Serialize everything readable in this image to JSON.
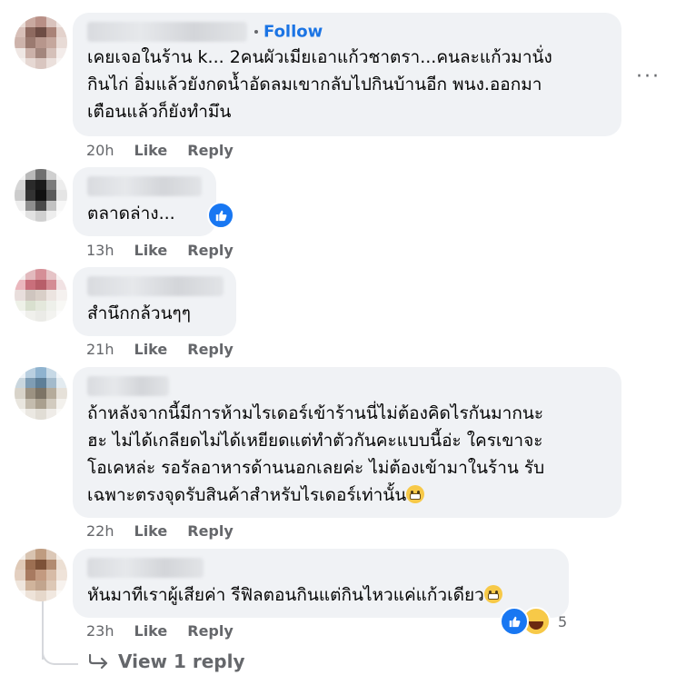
{
  "colors": {
    "bubble": "#f0f2f5",
    "link": "#1b74e4",
    "meta": "#65676b",
    "like_blue": "#1877f2"
  },
  "comments": [
    {
      "follow_label": "Follow",
      "text": "เคยเจอในร้าน k... 2คนผัวเมียเอาแก้วชาตรา...คนละแก้วมานั่ง\nกินไก่ อิ่มแล้วยังกดน้ำอัดลมเขากลับไปกินบ้านอีก พนง.ออกมา\nเตือนแล้วก็ยังทำมึน",
      "time": "20h",
      "like": "Like",
      "reply": "Reply"
    },
    {
      "text": "ตลาดล่าง...",
      "time": "13h",
      "like": "Like",
      "reply": "Reply",
      "reaction_icon": "like-icon"
    },
    {
      "text": "สำนึกกล้วนๆๆ",
      "time": "21h",
      "like": "Like",
      "reply": "Reply"
    },
    {
      "text": "ถ้าหลังจากนี้มีการห้ามไรเดอร์เข้าร้านนี่ไม่ต้องคิดไรกันมากนะ\nฮะ ไม่ได้เกลียดไม่ได้เหยียดแต่ทำตัวกันคะแบบนี้อ่ะ ใครเขาจะ\nโอเคหล่ะ รอรัลอาหารด้านนอกเลยค่ะ ไม่ต้องเข้ามาในร้าน รับ\nเฉพาะตรงจุดรับสินค้าสำหรับไรเดอร์เท่านั้น",
      "emoji": "grimacing-emoji",
      "time": "22h",
      "like": "Like",
      "reply": "Reply"
    },
    {
      "text": "หันมาทีเราผู้เสียค่า รีฟิลตอนกินแต่กินไหวแค่แก้วเดียว",
      "emoji": "sweat-smile-emoji",
      "time": "23h",
      "like": "Like",
      "reply": "Reply",
      "reactions": {
        "icons": [
          "like-icon",
          "haha-icon"
        ],
        "count": "5"
      }
    }
  ],
  "more_options": "···",
  "view_reply": "View 1 reply"
}
